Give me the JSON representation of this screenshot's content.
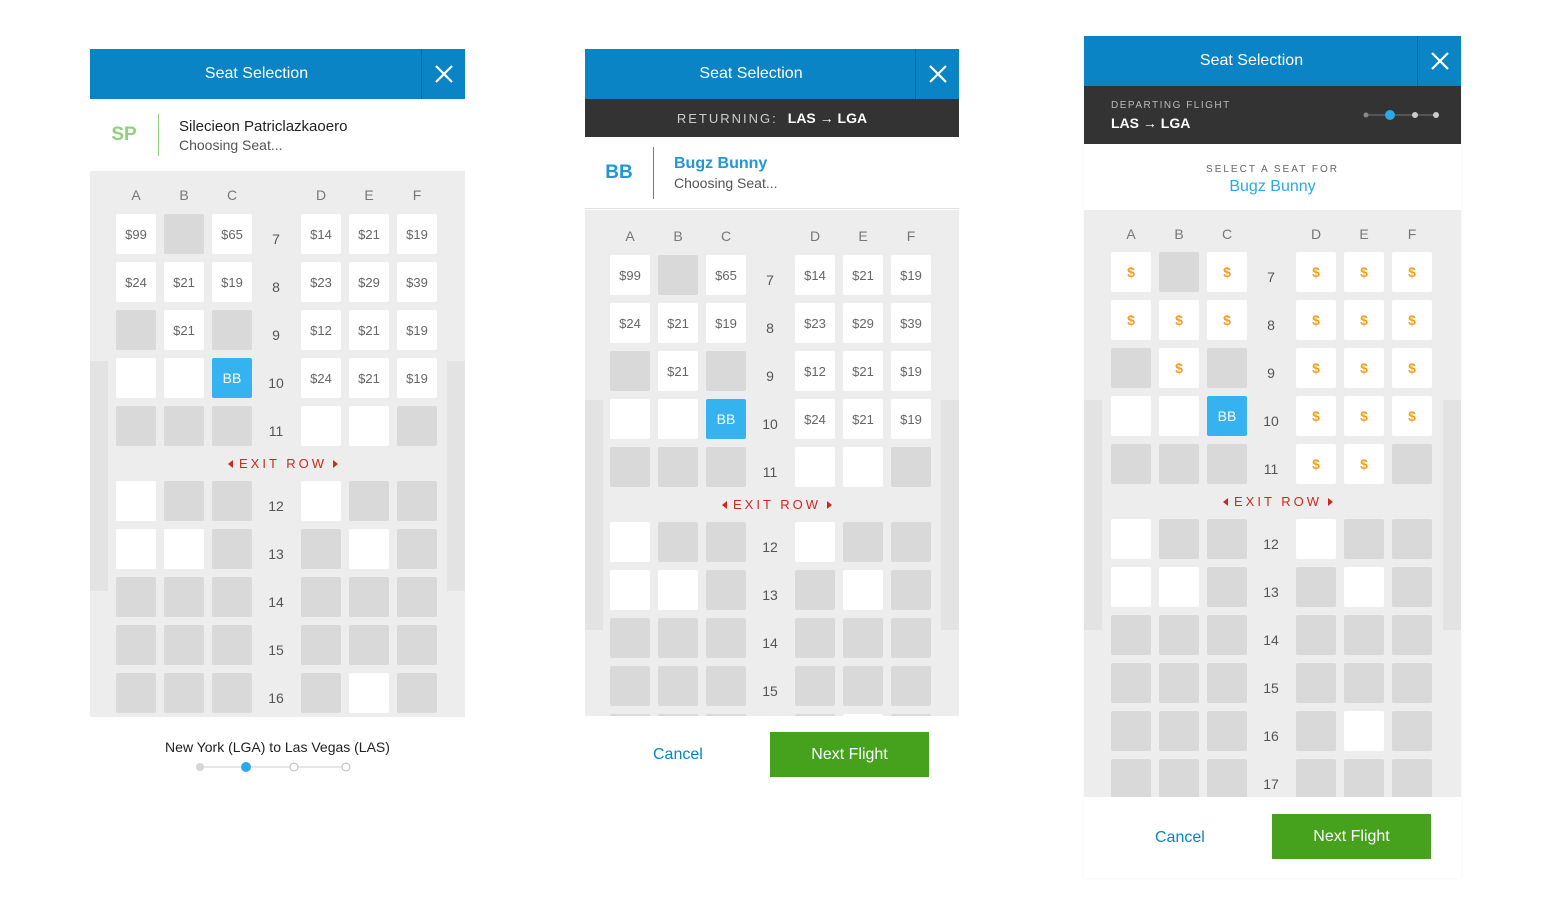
{
  "colors": {
    "header": "#0a84c4",
    "selected_seat": "#35b3f0",
    "exit_row": "#d0281e",
    "next_button": "#46a11c",
    "price_gold": "#f0a020"
  },
  "columns": [
    "A",
    "B",
    "C",
    "D",
    "E",
    "F"
  ],
  "exit_row_label": "EXIT ROW",
  "panel1": {
    "title": "Seat Selection",
    "passenger": {
      "initials": "SP",
      "name": "Silecieon Patriclazkaoero",
      "status": "Choosing Seat..."
    },
    "rows": [
      {
        "num": "7",
        "seats": [
          "$99",
          "",
          "$65",
          "$14",
          "$21",
          "$19"
        ]
      },
      {
        "num": "8",
        "seats": [
          "$24",
          "$21",
          "$19",
          "$23",
          "$29",
          "$39"
        ]
      },
      {
        "num": "9",
        "seats": [
          "",
          "$21",
          "",
          "$12",
          "$21",
          "$19"
        ]
      },
      {
        "num": "10",
        "seats": [
          "",
          "",
          "BB",
          "$24",
          "$21",
          "$19"
        ]
      },
      {
        "num": "11",
        "seats": [
          "",
          "",
          "",
          "",
          "",
          ""
        ]
      },
      {
        "num": "12",
        "seats": [
          "",
          "",
          "",
          "",
          "",
          ""
        ]
      },
      {
        "num": "13",
        "seats": [
          "",
          "",
          "",
          "",
          "",
          ""
        ]
      },
      {
        "num": "14",
        "seats": [
          "",
          "",
          "",
          "",
          "",
          ""
        ]
      },
      {
        "num": "15",
        "seats": [
          "",
          "",
          "",
          "",
          "",
          ""
        ]
      },
      {
        "num": "16",
        "seats": [
          "",
          "",
          "",
          "",
          "",
          ""
        ]
      }
    ],
    "route_label": "New York (LGA) to Las Vegas (LAS)"
  },
  "panel2": {
    "title": "Seat Selection",
    "returning_label": "RETURNING:",
    "returning_route": "LAS → LGA",
    "passenger": {
      "initials": "BB",
      "name": "Bugz Bunny",
      "status": "Choosing Seat..."
    },
    "rows": [
      {
        "num": "7",
        "seats": [
          "$99",
          "",
          "$65",
          "$14",
          "$21",
          "$19"
        ]
      },
      {
        "num": "8",
        "seats": [
          "$24",
          "$21",
          "$19",
          "$23",
          "$29",
          "$39"
        ]
      },
      {
        "num": "9",
        "seats": [
          "",
          "$21",
          "",
          "$12",
          "$21",
          "$19"
        ]
      },
      {
        "num": "10",
        "seats": [
          "",
          "",
          "BB",
          "$24",
          "$21",
          "$19"
        ]
      },
      {
        "num": "11",
        "seats": [
          "",
          "",
          "",
          "",
          "",
          ""
        ]
      },
      {
        "num": "12",
        "seats": [
          "",
          "",
          "",
          "",
          "",
          ""
        ]
      },
      {
        "num": "13",
        "seats": [
          "",
          "",
          "",
          "",
          "",
          ""
        ]
      },
      {
        "num": "14",
        "seats": [
          "",
          "",
          "",
          "",
          "",
          ""
        ]
      },
      {
        "num": "15",
        "seats": [
          "",
          "",
          "",
          "",
          "",
          ""
        ]
      },
      {
        "num": "",
        "seats": [
          "",
          "",
          "",
          "",
          "",
          ""
        ]
      }
    ],
    "cancel_label": "Cancel",
    "next_label": "Next Flight"
  },
  "panel3": {
    "title": "Seat Selection",
    "departing_label": "DEPARTING FLIGHT",
    "departing_route": "LAS → LGA",
    "select_label": "SELECT A SEAT FOR",
    "select_name": "Bugz Bunny",
    "rows": [
      {
        "num": "7",
        "seats": [
          "$",
          "",
          "$",
          "$",
          "$",
          "$"
        ]
      },
      {
        "num": "8",
        "seats": [
          "$",
          "$",
          "$",
          "$",
          "$",
          "$"
        ]
      },
      {
        "num": "9",
        "seats": [
          "",
          "$",
          "",
          "$",
          "$",
          "$"
        ]
      },
      {
        "num": "10",
        "seats": [
          "",
          "",
          "BB",
          "$",
          "$",
          "$"
        ]
      },
      {
        "num": "11",
        "seats": [
          "",
          "",
          "",
          "$",
          "$",
          ""
        ]
      },
      {
        "num": "12",
        "seats": [
          "",
          "",
          "",
          "",
          "",
          ""
        ]
      },
      {
        "num": "13",
        "seats": [
          "",
          "",
          "",
          "",
          "",
          ""
        ]
      },
      {
        "num": "14",
        "seats": [
          "",
          "",
          "",
          "",
          "",
          ""
        ]
      },
      {
        "num": "15",
        "seats": [
          "",
          "",
          "",
          "",
          "",
          ""
        ]
      },
      {
        "num": "16",
        "seats": [
          "",
          "",
          "",
          "",
          "",
          ""
        ]
      },
      {
        "num": "17",
        "seats": [
          "",
          "",
          "",
          "",
          "",
          ""
        ]
      }
    ],
    "cancel_label": "Cancel",
    "next_label": "Next Flight"
  }
}
